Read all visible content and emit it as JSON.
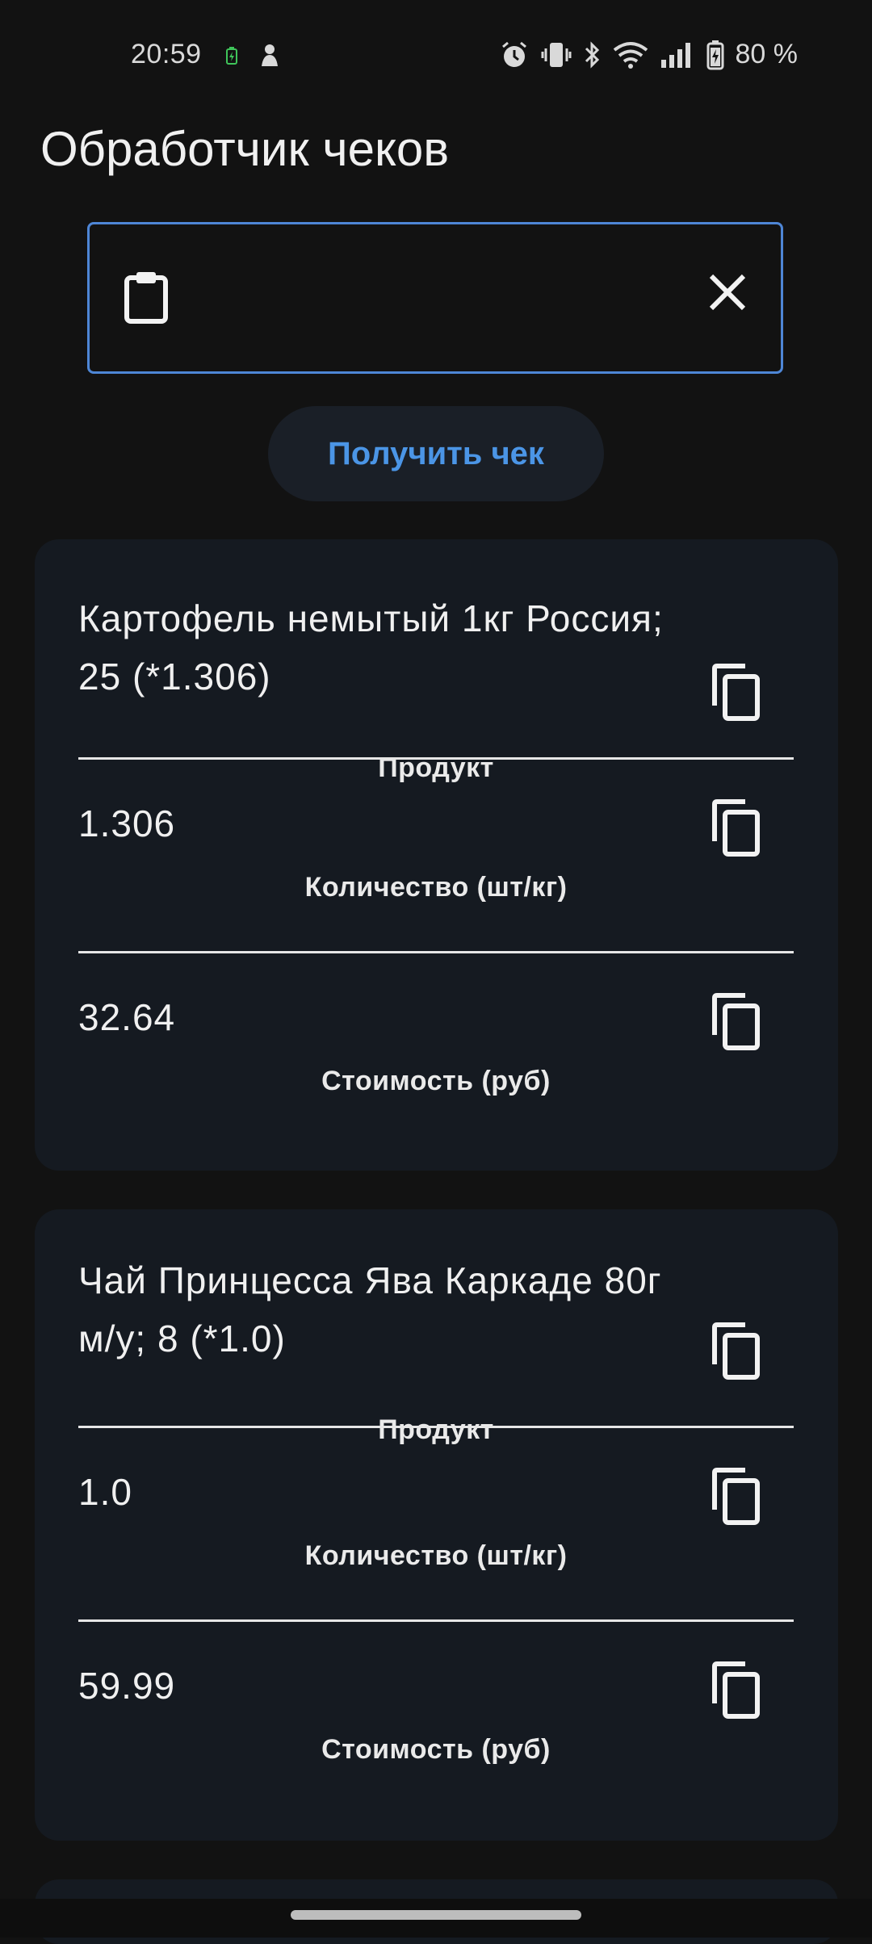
{
  "status_bar": {
    "time": "20:59",
    "battery_percent": "80 %",
    "icons": [
      "battery-charging-icon",
      "app-notification-icon",
      "alarm-icon",
      "vibrate-icon",
      "bluetooth-icon",
      "wifi-icon",
      "signal-icon",
      "battery-icon"
    ]
  },
  "app": {
    "title": "Обработчик чеков"
  },
  "receipt_input": {
    "value": "",
    "placeholder": ""
  },
  "get_button": {
    "label": "Получить чек"
  },
  "items": [
    {
      "product": "Картофель немытый 1кг Россия; 25 (*1.306)",
      "product_caption": "Продукт",
      "quantity": "1.306",
      "quantity_caption": "Количество (шт/кг)",
      "cost": "32.64",
      "cost_caption": "Стоимость (руб)"
    },
    {
      "product": "Чай Принцесса Ява Каркаде 80г м/у; 8 (*1.0)",
      "product_caption": "Продукт",
      "quantity": "1.0",
      "quantity_caption": "Количество (шт/кг)",
      "cost": "59.99",
      "cost_caption": "Стоимость (руб)"
    }
  ],
  "colors": {
    "background": "#121212",
    "card": "#151a21",
    "accent": "#4b95e6",
    "input_border": "#4e86d6"
  }
}
